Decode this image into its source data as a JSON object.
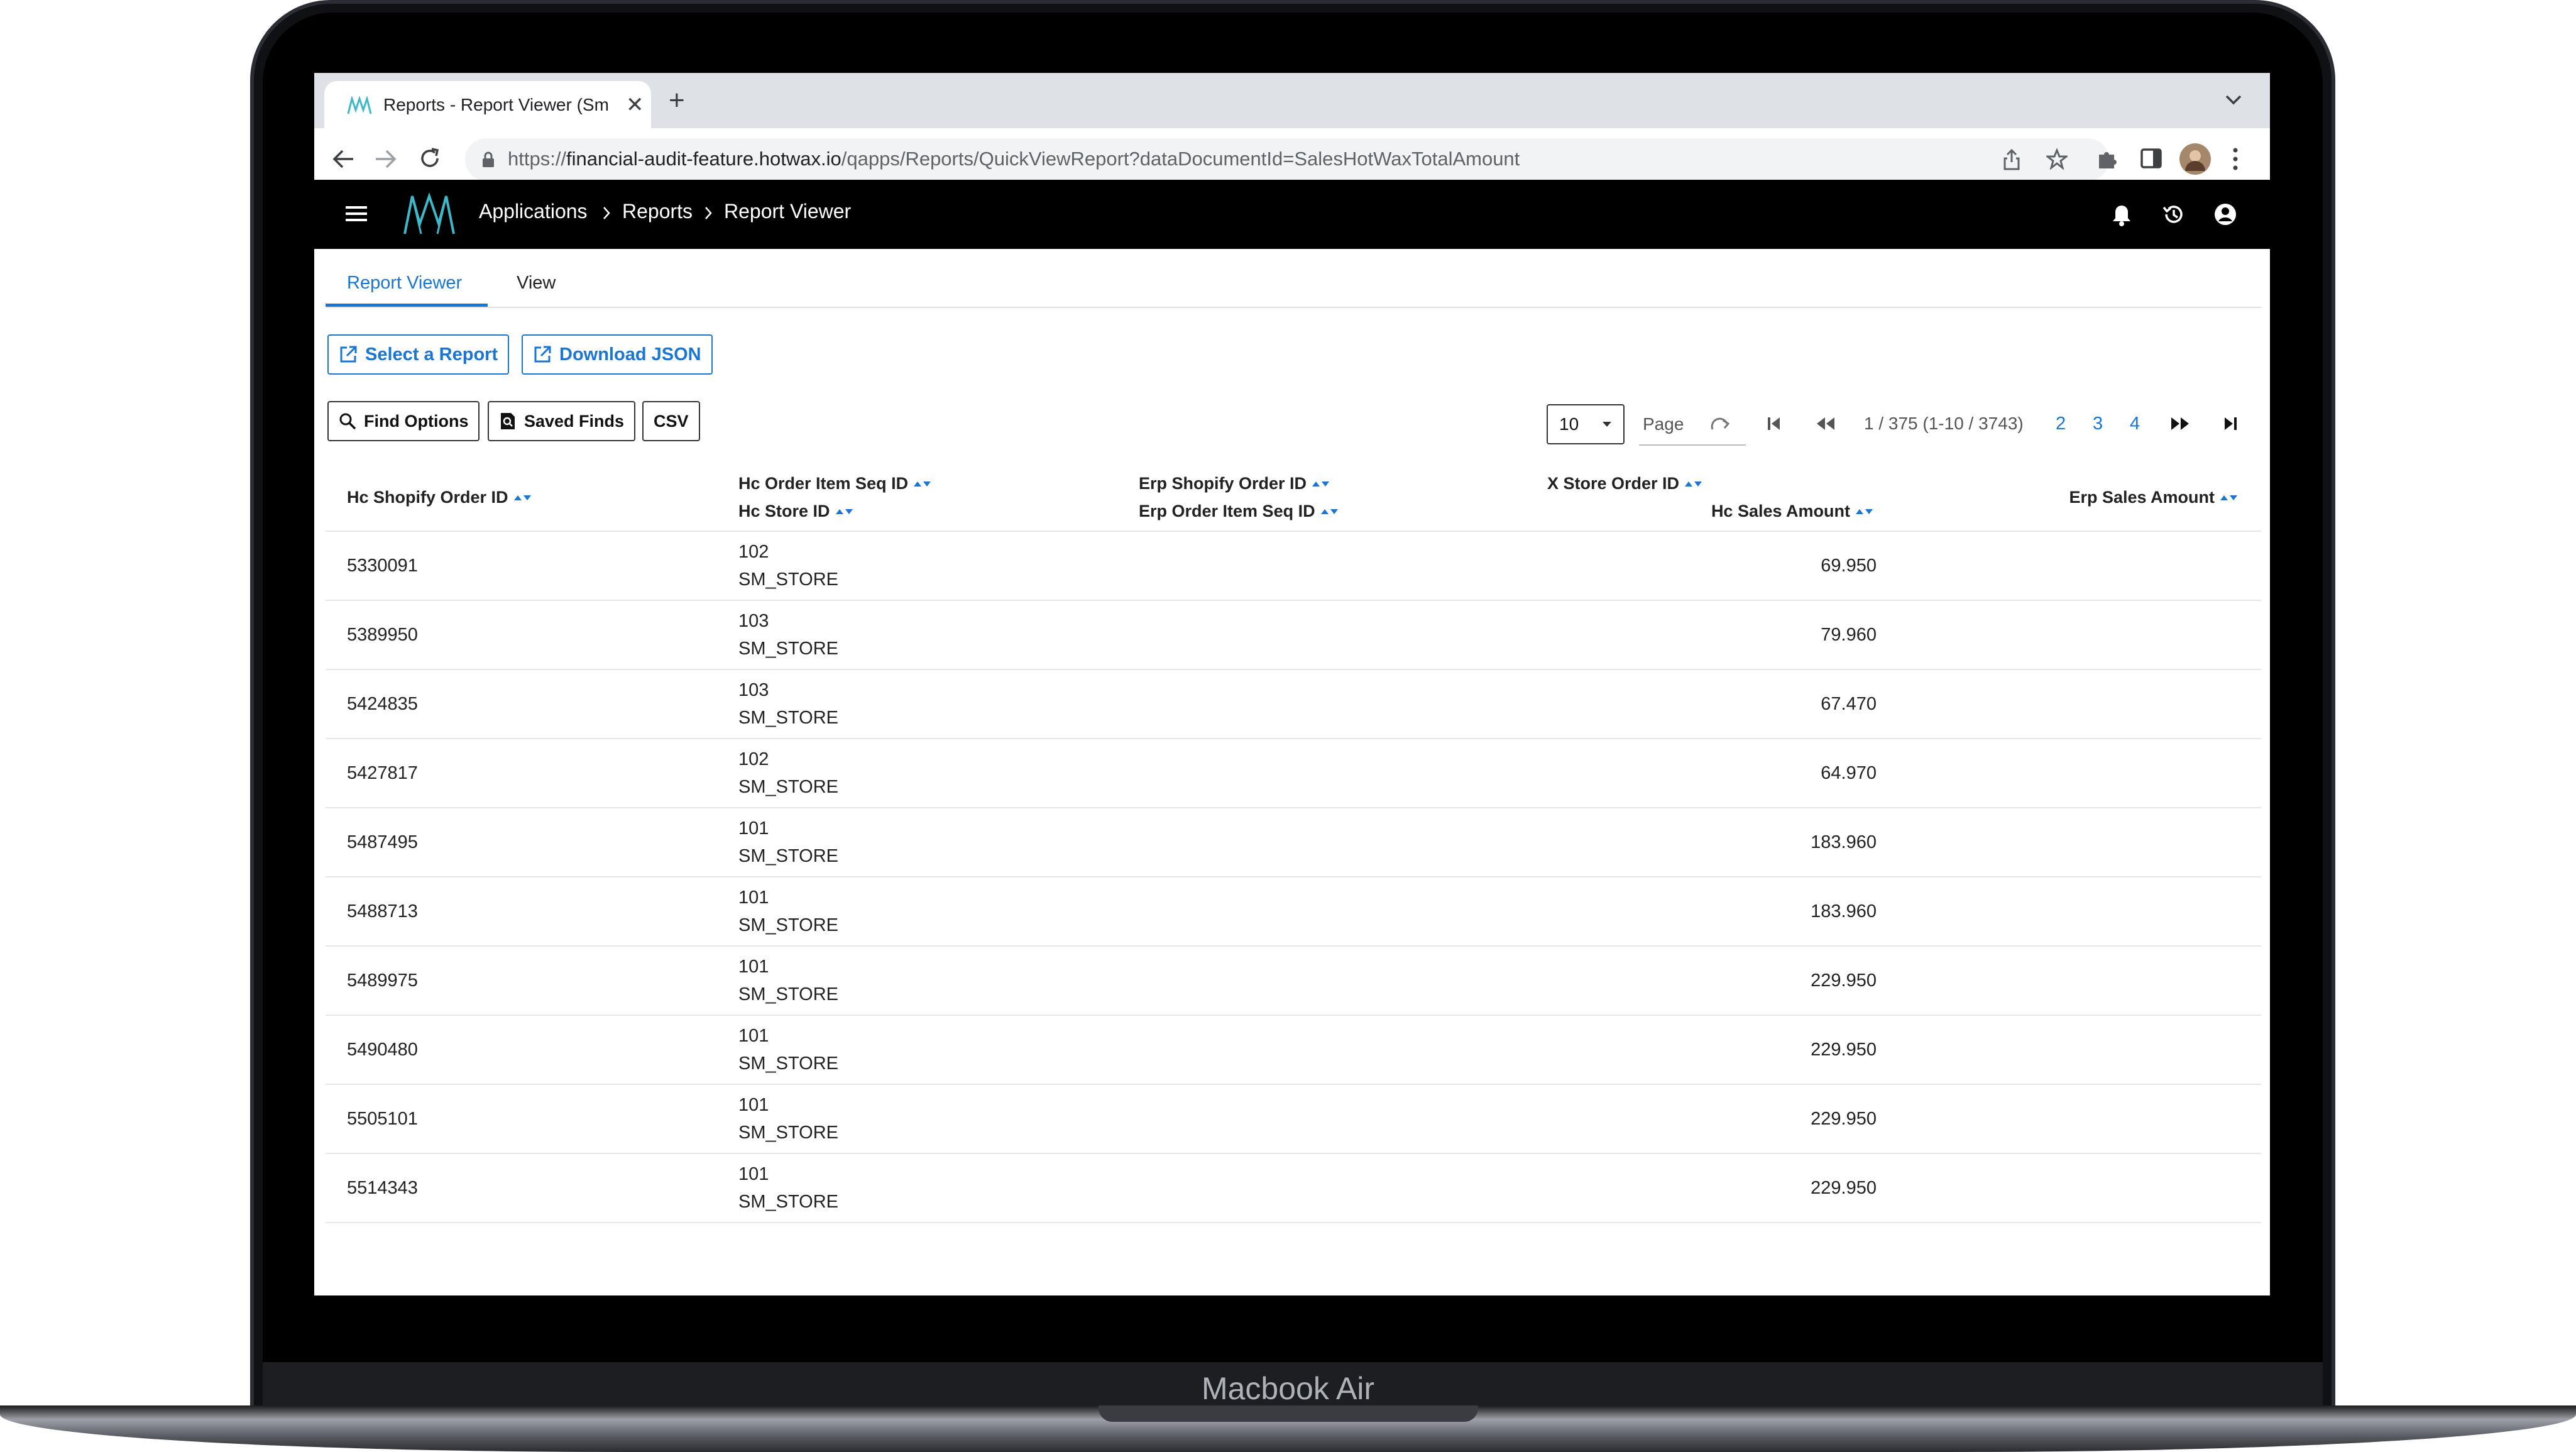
{
  "device": {
    "label": "Macbook Air"
  },
  "browser": {
    "tab_title": "Reports - Report Viewer (SmS",
    "url_prefix": "https://",
    "url_host": "financial-audit-feature.hotwax.io",
    "url_path": "/qapps/Reports/QuickViewReport?dataDocumentId=SalesHotWaxTotalAmount"
  },
  "appbar": {
    "breadcrumb": [
      "Applications",
      "Reports",
      "Report Viewer"
    ]
  },
  "tabs": [
    {
      "label": "Report Viewer",
      "active": true
    },
    {
      "label": "View",
      "active": false
    }
  ],
  "actions": {
    "select_report": "Select a Report",
    "download_json": "Download JSON",
    "find_options": "Find Options",
    "saved_finds": "Saved Finds",
    "csv": "CSV"
  },
  "pagination": {
    "page_size": "10",
    "page_label": "Page",
    "summary": "1 / 375 (1-10 / 3743)",
    "pages": [
      "2",
      "3",
      "4"
    ]
  },
  "columns": {
    "hc_shopify_order_id": "Hc Shopify Order ID",
    "hc_order_item_seq_id": "Hc Order Item Seq ID",
    "hc_store_id": "Hc Store ID",
    "erp_shopify_order_id": "Erp Shopify Order ID",
    "erp_order_item_seq_id": "Erp Order Item Seq ID",
    "x_store_order_id": "X Store Order ID",
    "hc_sales_amount": "Hc Sales Amount",
    "erp_sales_amount": "Erp Sales Amount"
  },
  "rows": [
    {
      "order_id": "5330091",
      "seq": "102",
      "store": "SM_STORE",
      "amount": "69.950"
    },
    {
      "order_id": "5389950",
      "seq": "103",
      "store": "SM_STORE",
      "amount": "79.960"
    },
    {
      "order_id": "5424835",
      "seq": "103",
      "store": "SM_STORE",
      "amount": "67.470"
    },
    {
      "order_id": "5427817",
      "seq": "102",
      "store": "SM_STORE",
      "amount": "64.970"
    },
    {
      "order_id": "5487495",
      "seq": "101",
      "store": "SM_STORE",
      "amount": "183.960"
    },
    {
      "order_id": "5488713",
      "seq": "101",
      "store": "SM_STORE",
      "amount": "183.960"
    },
    {
      "order_id": "5489975",
      "seq": "101",
      "store": "SM_STORE",
      "amount": "229.950"
    },
    {
      "order_id": "5490480",
      "seq": "101",
      "store": "SM_STORE",
      "amount": "229.950"
    },
    {
      "order_id": "5505101",
      "seq": "101",
      "store": "SM_STORE",
      "amount": "229.950"
    },
    {
      "order_id": "5514343",
      "seq": "101",
      "store": "SM_STORE",
      "amount": "229.950"
    }
  ],
  "colors": {
    "accent": "#1976d2",
    "appbar": "#000000",
    "logo": "#3fb8c9"
  }
}
